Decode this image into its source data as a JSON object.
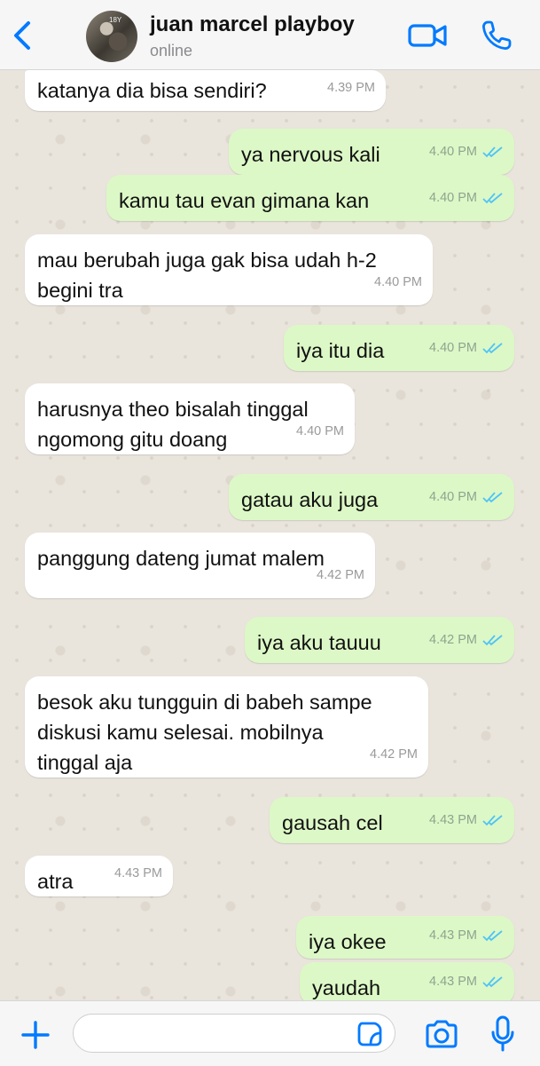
{
  "header": {
    "contact_name": "juan marcel playboy",
    "status": "online",
    "avatar_text": "18Y",
    "icons": [
      "chevron-left-icon",
      "video-camera-icon",
      "phone-icon"
    ]
  },
  "colors": {
    "accent": "#007aff",
    "outgoing_bubble": "#dcf8c6",
    "incoming_bubble": "#ffffff",
    "read_ticks": "#4fc3f7",
    "chat_background": "#e9e4dc"
  },
  "messages": [
    {
      "direction": "in",
      "text": "katanya dia bisa sendiri?",
      "time": "4.39 PM"
    },
    {
      "direction": "out",
      "text": "ya nervous kali",
      "time": "4.40 PM",
      "read": true
    },
    {
      "direction": "out",
      "text": "kamu tau evan gimana kan",
      "time": "4.40 PM",
      "read": true
    },
    {
      "direction": "in",
      "text": "mau berubah juga gak bisa udah h-2\nbegini tra",
      "time": "4.40 PM"
    },
    {
      "direction": "out",
      "text": "iya itu dia",
      "time": "4.40 PM",
      "read": true
    },
    {
      "direction": "in",
      "text": "harusnya theo bisalah tinggal\nngomong gitu doang",
      "time": "4.40 PM"
    },
    {
      "direction": "out",
      "text": "gatau aku juga",
      "time": "4.40 PM",
      "read": true
    },
    {
      "direction": "in",
      "text": "panggung dateng jumat malem",
      "time": "4.42 PM"
    },
    {
      "direction": "out",
      "text": "iya aku tauuu",
      "time": "4.42 PM",
      "read": true
    },
    {
      "direction": "in",
      "text": "besok aku tungguin di babeh sampe\ndiskusi kamu selesai. mobilnya\ntinggal aja",
      "time": "4.42 PM"
    },
    {
      "direction": "out",
      "text": "gausah cel",
      "time": "4.43 PM",
      "read": true
    },
    {
      "direction": "in",
      "text": "atra",
      "time": "4.43 PM"
    },
    {
      "direction": "out",
      "text": "iya okee",
      "time": "4.43 PM",
      "read": true
    },
    {
      "direction": "out",
      "text": "yaudah",
      "time": "4.43 PM",
      "read": true
    }
  ],
  "input_bar": {
    "placeholder": "",
    "icons": [
      "plus-icon",
      "sticker-icon",
      "camera-icon",
      "microphone-icon"
    ]
  }
}
